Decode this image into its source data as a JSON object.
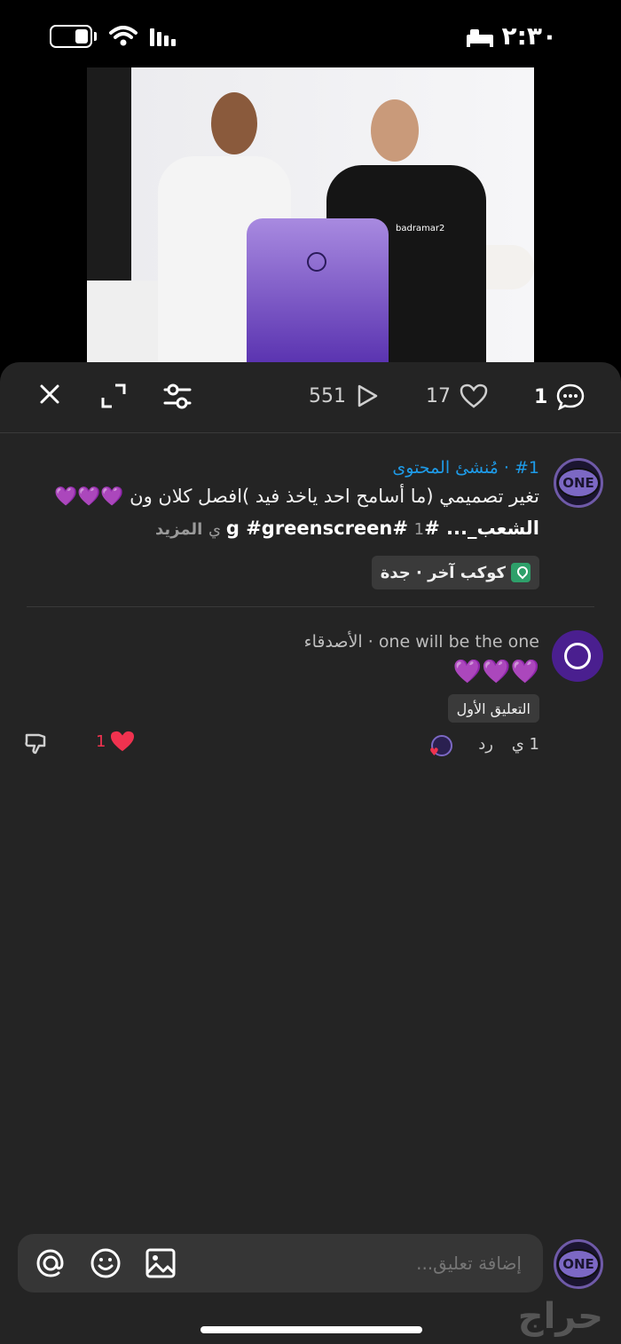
{
  "status_bar": {
    "time": "٢:٣٠"
  },
  "video": {
    "watermark": "badramar2"
  },
  "toolbar": {
    "views": "551",
    "likes": "17",
    "comments": "1"
  },
  "post": {
    "meta": "#1 · مُنشئ المحتوى",
    "avatar_label": "ONE",
    "text_line1": "تغير تصميمي (ما أسامح احد ياخذ فيد )افصل كلان ون 💜💜💜",
    "text_line2_bold": "الشعب_... #g #greenscreen#",
    "text_line2_time": "1 ي",
    "more": "المزيد",
    "location": "كوكب آخر · جدة"
  },
  "comment": {
    "meta": "one will be the one · الأصدقاء",
    "text": "💜💜💜",
    "badge": "التعليق الأول",
    "time": "1 ي",
    "reply": "رد",
    "like_count": "1"
  },
  "composer": {
    "placeholder": "إضافة تعليق...",
    "avatar_label": "ONE"
  },
  "watermark_logo": "حراج"
}
